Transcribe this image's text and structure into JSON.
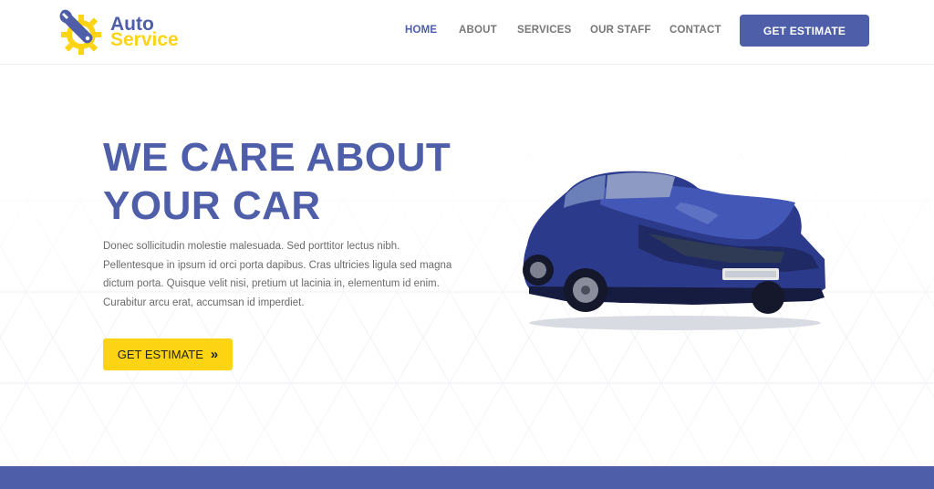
{
  "brand": {
    "name_line1": "Auto",
    "name_line2": "Service",
    "logo_icon": "wrench-gear-icon"
  },
  "nav": {
    "items": [
      {
        "label": "HOME",
        "active": true
      },
      {
        "label": "ABOUT",
        "active": false
      },
      {
        "label": "SERVICES",
        "active": false
      },
      {
        "label": "OUR STAFF",
        "active": false
      },
      {
        "label": "CONTACT",
        "active": false
      }
    ],
    "cta_label": "GET ESTIMATE"
  },
  "hero": {
    "headline_line1": "WE CARE ABOUT",
    "headline_line2": "YOUR CAR",
    "body": "Donec sollicitudin molestie malesuada. Sed porttitor lectus nibh. Pellentesque in ipsum id orci porta dapibus. Cras ultricies ligula sed magna dictum porta. Quisque velit nisi, pretium ut lacinia in, elementum id enim. Curabitur arcu erat, accumsan id imperdiet.",
    "cta_label": "GET ESTIMATE",
    "cta_icon": "double-chevron-right-icon",
    "image": "damaged-blue-car"
  },
  "colors": {
    "brand_blue": "#4e5ea8",
    "brand_yellow": "#fcd413",
    "nav_text": "#777777",
    "body_text": "#6b6b6b"
  }
}
